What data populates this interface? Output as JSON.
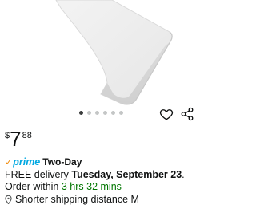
{
  "product": {
    "image_alt": "mattress pad product image",
    "carousel": {
      "total": 6,
      "active": 0
    }
  },
  "actions": {
    "wishlist_icon": "heart-icon",
    "share_icon": "share-icon"
  },
  "price": {
    "symbol": "$",
    "whole": "7",
    "fraction": "88"
  },
  "shipping": {
    "prime_label": "prime",
    "two_day": "Two-Day",
    "delivery_prefix": "FREE delivery ",
    "delivery_date": "Tuesday, September 23",
    "delivery_mid": ". Order within ",
    "countdown": "3 hrs 32 mins",
    "distance_text": "Shorter shipping distance M"
  },
  "colors": {
    "prime_blue": "#00a8e1",
    "prime_check": "#f08804",
    "countdown_green": "#007600"
  }
}
